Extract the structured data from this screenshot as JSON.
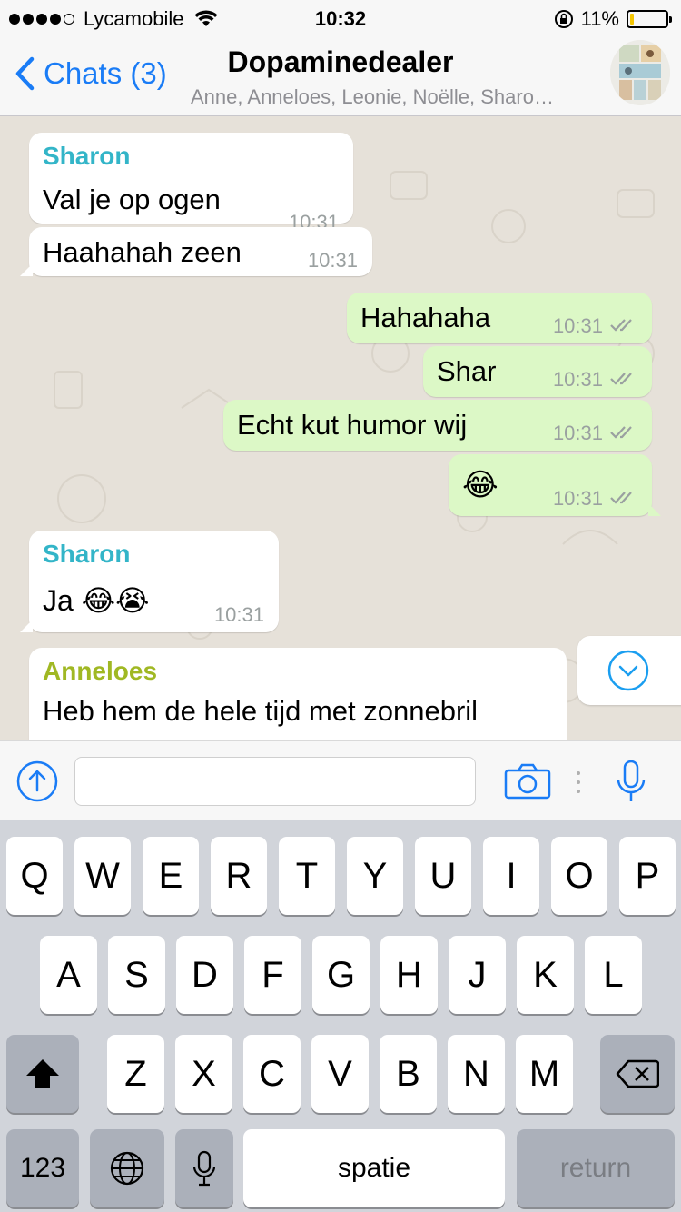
{
  "status": {
    "carrier": "Lycamobile",
    "time": "10:32",
    "battery": "11%",
    "battery_level": 0.11,
    "signal_icon": "signal-dots-icon",
    "wifi_icon": "wifi-icon",
    "lock_icon": "orientation-lock-icon"
  },
  "nav": {
    "back_label": "Chats (3)",
    "title": "Dopaminedealer",
    "subtitle": "Anne, Anneloes, Leonie, Noëlle, Sharo…"
  },
  "colors": {
    "sender_sharon": "#33b5c8",
    "sender_anneloes": "#a0b823",
    "accent": "#1a7cf6",
    "outgoing_bubble": "#dcf8c6",
    "read_checks": "#9aa0a0"
  },
  "messages": [
    {
      "sender": "Sharon",
      "text": "Val je op ogen",
      "time": "10:31"
    },
    {
      "text": "Haahahah zeen",
      "time": "10:31"
    },
    {
      "text": "Hahahaha",
      "time": "10:31"
    },
    {
      "text": "Shar",
      "time": "10:31"
    },
    {
      "text": "Echt kut humor wij",
      "time": "10:31"
    },
    {
      "text": "😂",
      "time": "10:31"
    },
    {
      "sender": "Sharon",
      "text": "Ja 😂😭",
      "time": "10:31"
    },
    {
      "sender": "Anneloes",
      "text": "Heb hem de hele tijd met zonnebril",
      "time": ""
    }
  ],
  "input": {
    "placeholder": "",
    "value": ""
  },
  "keyboard": {
    "row1": [
      "Q",
      "W",
      "E",
      "R",
      "T",
      "Y",
      "U",
      "I",
      "O",
      "P"
    ],
    "row2": [
      "A",
      "S",
      "D",
      "F",
      "G",
      "H",
      "J",
      "K",
      "L"
    ],
    "row3": [
      "Z",
      "X",
      "C",
      "V",
      "B",
      "N",
      "M"
    ],
    "numbers_label": "123",
    "space_label": "spatie",
    "return_label": "return"
  }
}
